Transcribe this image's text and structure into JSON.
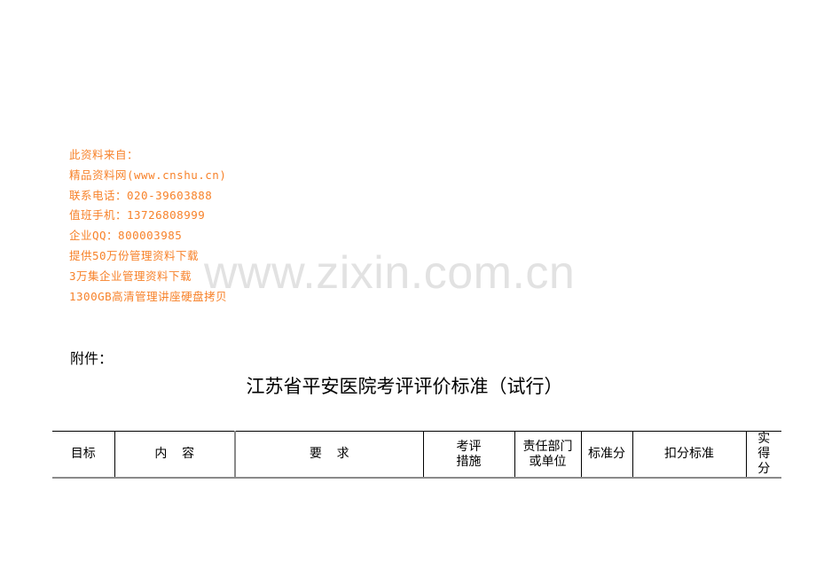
{
  "ad_block": {
    "lines": [
      "此资料来自：",
      "精品资料网(www.cnshu.cn)",
      "联系电话：020-39603888",
      "值班手机：13726808999",
      "企业QQ：800003985",
      "提供50万份管理资料下载",
      "3万集企业管理资料下载",
      "1300GB高清管理讲座硬盘拷贝"
    ],
    "color": "#f7822a"
  },
  "watermark": {
    "text": "www.zixin.com.cn",
    "color": "#e2e2e2"
  },
  "attachment_label": "附件：",
  "document_title": "江苏省平安医院考评评价标准（试行）",
  "table": {
    "headers": [
      {
        "line1": "目标"
      },
      {
        "line1": "内容"
      },
      {
        "line1": "要求"
      },
      {
        "line1": "考评",
        "line2": "措施"
      },
      {
        "line1": "责任部门",
        "line2": "或单位"
      },
      {
        "line1": "标准分"
      },
      {
        "line1": "扣分标准"
      },
      {
        "line1": "实",
        "line2": "得",
        "line3": "分"
      }
    ]
  }
}
